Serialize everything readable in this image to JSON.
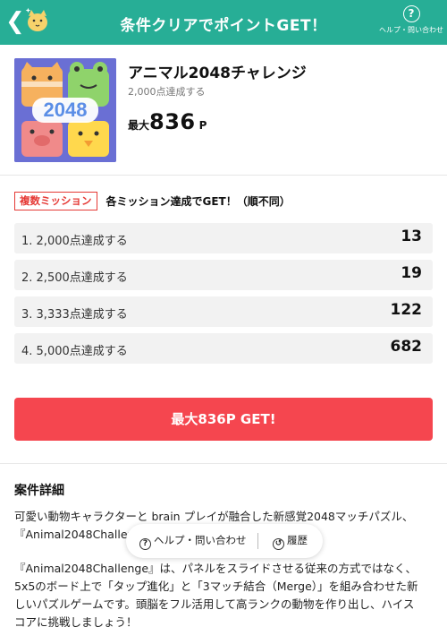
{
  "header": {
    "title": "条件クリアでポイントGET！",
    "help_label": "ヘルプ・問い合わせ",
    "help_icon": "?",
    "back_icon": "chevron-left-icon",
    "mascot_icon": "cat-mascot-icon",
    "color": "#27ae96"
  },
  "game": {
    "title": "アニマル2048チャレンジ",
    "subtitle": "2,000点達成する",
    "thumb_text": "2048",
    "max_prefix": "最大",
    "max_value": "836",
    "max_unit": "P"
  },
  "missions": {
    "badge": "複数ミッション",
    "description": "各ミッション達成でGET！（順不同）",
    "items": [
      {
        "label": "1. 2,000点達成する",
        "points": "13"
      },
      {
        "label": "2. 2,500点達成する",
        "points": "19"
      },
      {
        "label": "3. 3,333点達成する",
        "points": "122"
      },
      {
        "label": "4. 5,000点達成する",
        "points": "682"
      }
    ]
  },
  "cta": {
    "label": "最大836P GET!",
    "color": "#f5464f"
  },
  "details": {
    "title": "案件詳細",
    "para1": "可愛い動物キャラクターと brain プレイが融合した新感覚2048マッチパズル、\n『Animal2048Challenge』",
    "para2": "『Animal2048Challenge』は、パネルをスライドさせる従来の方式ではなく、\n5x5のボード上で「タップ進化」と「3マッチ結合（Merge）」を組み合わせた新\nしいパズルゲームです。頭脳をフル活用して高ランクの動物を作り出し、ハイス\nコアに挑戦しましょう！"
  },
  "pill": {
    "help_label": "ヘルプ・問い合わせ",
    "history_label": "履歴"
  }
}
